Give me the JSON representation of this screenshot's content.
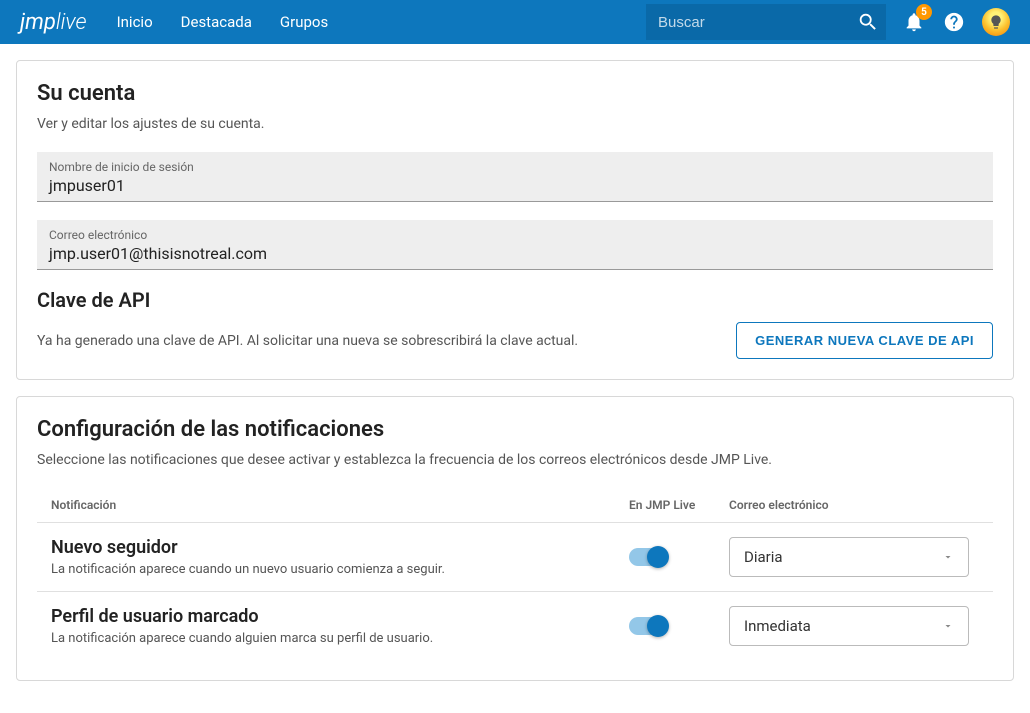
{
  "header": {
    "logo_jmp": "jmp",
    "logo_live": "live",
    "nav": {
      "home": "Inicio",
      "featured": "Destacada",
      "groups": "Grupos"
    },
    "search_placeholder": "Buscar",
    "badge_count": "5"
  },
  "account": {
    "title": "Su cuenta",
    "subtitle": "Ver y editar los ajustes de su cuenta.",
    "username_label": "Nombre de inicio de sesión",
    "username_value": "jmpuser01",
    "email_label": "Correo electrónico",
    "email_value": "jmp.user01@thisisnotreal.com",
    "api_title": "Clave de API",
    "api_text": "Ya ha generado una clave de API. Al solicitar una nueva se sobrescribirá la clave actual.",
    "api_button": "GENERAR NUEVA CLAVE DE API"
  },
  "notifications": {
    "title": "Configuración de las notificaciones",
    "subtitle": "Seleccione las notificaciones que desee activar y establezca la frecuencia de los correos electrónicos desde JMP Live.",
    "col_notification": "Notificación",
    "col_jmplive": "En JMP Live",
    "col_email": "Correo electrónico",
    "rows": [
      {
        "title": "Nuevo seguidor",
        "desc": "La notificación aparece cuando un nuevo usuario comienza a seguir.",
        "email_freq": "Diaria"
      },
      {
        "title": "Perfil de usuario marcado",
        "desc": "La notificación aparece cuando alguien marca su perfil de usuario.",
        "email_freq": "Inmediata"
      }
    ]
  }
}
